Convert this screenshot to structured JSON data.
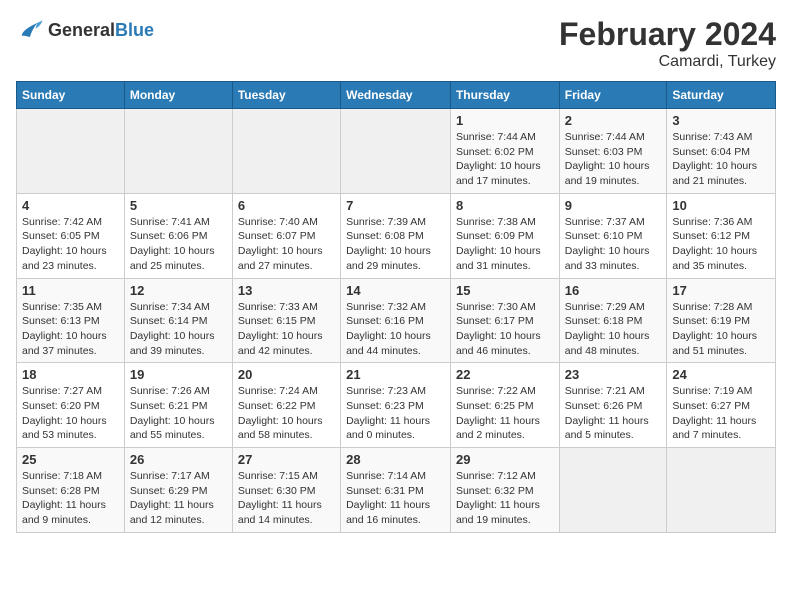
{
  "header": {
    "logo_general": "General",
    "logo_blue": "Blue",
    "title": "February 2024",
    "subtitle": "Camardi, Turkey"
  },
  "days_of_week": [
    "Sunday",
    "Monday",
    "Tuesday",
    "Wednesday",
    "Thursday",
    "Friday",
    "Saturday"
  ],
  "weeks": [
    [
      {
        "day": "",
        "info": ""
      },
      {
        "day": "",
        "info": ""
      },
      {
        "day": "",
        "info": ""
      },
      {
        "day": "",
        "info": ""
      },
      {
        "day": "1",
        "info": "Sunrise: 7:44 AM\nSunset: 6:02 PM\nDaylight: 10 hours\nand 17 minutes."
      },
      {
        "day": "2",
        "info": "Sunrise: 7:44 AM\nSunset: 6:03 PM\nDaylight: 10 hours\nand 19 minutes."
      },
      {
        "day": "3",
        "info": "Sunrise: 7:43 AM\nSunset: 6:04 PM\nDaylight: 10 hours\nand 21 minutes."
      }
    ],
    [
      {
        "day": "4",
        "info": "Sunrise: 7:42 AM\nSunset: 6:05 PM\nDaylight: 10 hours\nand 23 minutes."
      },
      {
        "day": "5",
        "info": "Sunrise: 7:41 AM\nSunset: 6:06 PM\nDaylight: 10 hours\nand 25 minutes."
      },
      {
        "day": "6",
        "info": "Sunrise: 7:40 AM\nSunset: 6:07 PM\nDaylight: 10 hours\nand 27 minutes."
      },
      {
        "day": "7",
        "info": "Sunrise: 7:39 AM\nSunset: 6:08 PM\nDaylight: 10 hours\nand 29 minutes."
      },
      {
        "day": "8",
        "info": "Sunrise: 7:38 AM\nSunset: 6:09 PM\nDaylight: 10 hours\nand 31 minutes."
      },
      {
        "day": "9",
        "info": "Sunrise: 7:37 AM\nSunset: 6:10 PM\nDaylight: 10 hours\nand 33 minutes."
      },
      {
        "day": "10",
        "info": "Sunrise: 7:36 AM\nSunset: 6:12 PM\nDaylight: 10 hours\nand 35 minutes."
      }
    ],
    [
      {
        "day": "11",
        "info": "Sunrise: 7:35 AM\nSunset: 6:13 PM\nDaylight: 10 hours\nand 37 minutes."
      },
      {
        "day": "12",
        "info": "Sunrise: 7:34 AM\nSunset: 6:14 PM\nDaylight: 10 hours\nand 39 minutes."
      },
      {
        "day": "13",
        "info": "Sunrise: 7:33 AM\nSunset: 6:15 PM\nDaylight: 10 hours\nand 42 minutes."
      },
      {
        "day": "14",
        "info": "Sunrise: 7:32 AM\nSunset: 6:16 PM\nDaylight: 10 hours\nand 44 minutes."
      },
      {
        "day": "15",
        "info": "Sunrise: 7:30 AM\nSunset: 6:17 PM\nDaylight: 10 hours\nand 46 minutes."
      },
      {
        "day": "16",
        "info": "Sunrise: 7:29 AM\nSunset: 6:18 PM\nDaylight: 10 hours\nand 48 minutes."
      },
      {
        "day": "17",
        "info": "Sunrise: 7:28 AM\nSunset: 6:19 PM\nDaylight: 10 hours\nand 51 minutes."
      }
    ],
    [
      {
        "day": "18",
        "info": "Sunrise: 7:27 AM\nSunset: 6:20 PM\nDaylight: 10 hours\nand 53 minutes."
      },
      {
        "day": "19",
        "info": "Sunrise: 7:26 AM\nSunset: 6:21 PM\nDaylight: 10 hours\nand 55 minutes."
      },
      {
        "day": "20",
        "info": "Sunrise: 7:24 AM\nSunset: 6:22 PM\nDaylight: 10 hours\nand 58 minutes."
      },
      {
        "day": "21",
        "info": "Sunrise: 7:23 AM\nSunset: 6:23 PM\nDaylight: 11 hours\nand 0 minutes."
      },
      {
        "day": "22",
        "info": "Sunrise: 7:22 AM\nSunset: 6:25 PM\nDaylight: 11 hours\nand 2 minutes."
      },
      {
        "day": "23",
        "info": "Sunrise: 7:21 AM\nSunset: 6:26 PM\nDaylight: 11 hours\nand 5 minutes."
      },
      {
        "day": "24",
        "info": "Sunrise: 7:19 AM\nSunset: 6:27 PM\nDaylight: 11 hours\nand 7 minutes."
      }
    ],
    [
      {
        "day": "25",
        "info": "Sunrise: 7:18 AM\nSunset: 6:28 PM\nDaylight: 11 hours\nand 9 minutes."
      },
      {
        "day": "26",
        "info": "Sunrise: 7:17 AM\nSunset: 6:29 PM\nDaylight: 11 hours\nand 12 minutes."
      },
      {
        "day": "27",
        "info": "Sunrise: 7:15 AM\nSunset: 6:30 PM\nDaylight: 11 hours\nand 14 minutes."
      },
      {
        "day": "28",
        "info": "Sunrise: 7:14 AM\nSunset: 6:31 PM\nDaylight: 11 hours\nand 16 minutes."
      },
      {
        "day": "29",
        "info": "Sunrise: 7:12 AM\nSunset: 6:32 PM\nDaylight: 11 hours\nand 19 minutes."
      },
      {
        "day": "",
        "info": ""
      },
      {
        "day": "",
        "info": ""
      }
    ]
  ]
}
